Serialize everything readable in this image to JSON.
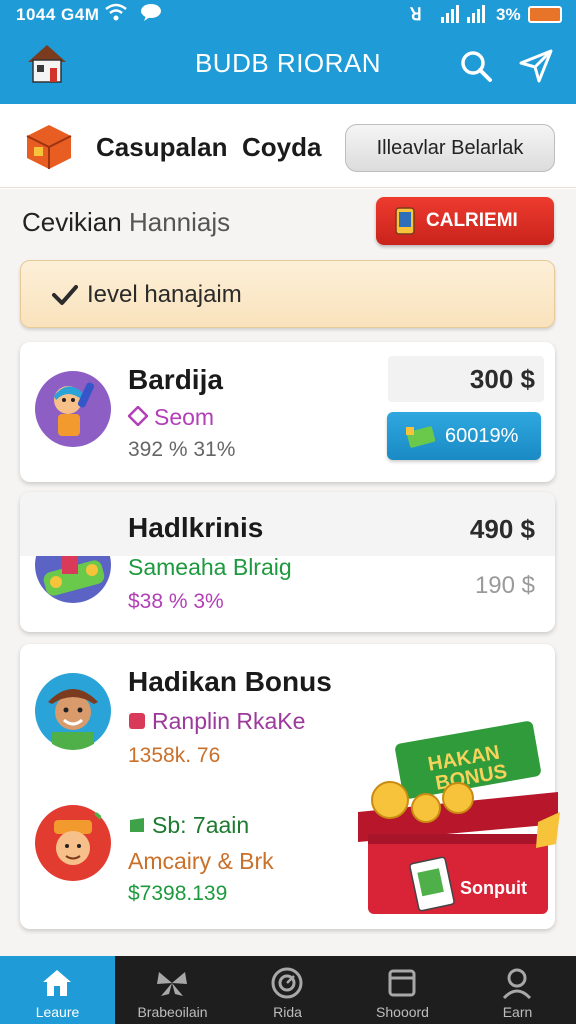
{
  "status_bar": {
    "time": "1044 G4M",
    "nfc": "ꓤ",
    "battery": "3%",
    "signal_icons": [
      "wifi-icon",
      "message-icon",
      "signal-icon",
      "battery-icon"
    ]
  },
  "app_bar": {
    "title": "BUDB RIORAN",
    "icons": [
      "house-logo-icon",
      "search-icon",
      "send-icon"
    ]
  },
  "header": {
    "name_primary": "Casupalan",
    "name_secondary": "Coyda",
    "button_label": "Illeavlar Belarlak"
  },
  "section": {
    "title_bold": "Cevikian",
    "title_light": "Hanniajs",
    "action_label": "CALRIEMI"
  },
  "level": {
    "label": "Ievel hanajaim"
  },
  "cards": [
    {
      "title": "Bardija",
      "subtitle": "Seom",
      "meta": "392 % 31%",
      "amount": "300 $",
      "pill_label": "60019%"
    },
    {
      "title": "Hadlkrinis",
      "subtitle": "Sameaha Blraig",
      "meta": "$38 % 3%",
      "amount": "490 $",
      "secondary_amount": "190 $"
    },
    {
      "title": "Hadikan Bonus",
      "subtitle": "Ranplin RkaKe",
      "meta": "1358k. 76",
      "sub2": "Sb: 7aain",
      "sub3": "Amcairy & Brk",
      "meta2": "$7398.139",
      "badge_top": "HAKAN",
      "badge_bottom": "BONUS",
      "chest_label": "Sonpuit"
    }
  ],
  "bottom_nav": [
    {
      "label": "Leaure",
      "icon": "home-icon",
      "active": true
    },
    {
      "label": "Brabeoilain",
      "icon": "butterfly-icon",
      "active": false
    },
    {
      "label": "Rida",
      "icon": "compass-icon",
      "active": false
    },
    {
      "label": "Shooord",
      "icon": "window-icon",
      "active": false
    },
    {
      "label": "Earn",
      "icon": "person-icon",
      "active": false
    }
  ],
  "colors": {
    "primary": "#1f9bd7",
    "danger": "#e0312a",
    "nav_bg": "#1e1e1e",
    "level_bg": "#fbe9cb"
  }
}
